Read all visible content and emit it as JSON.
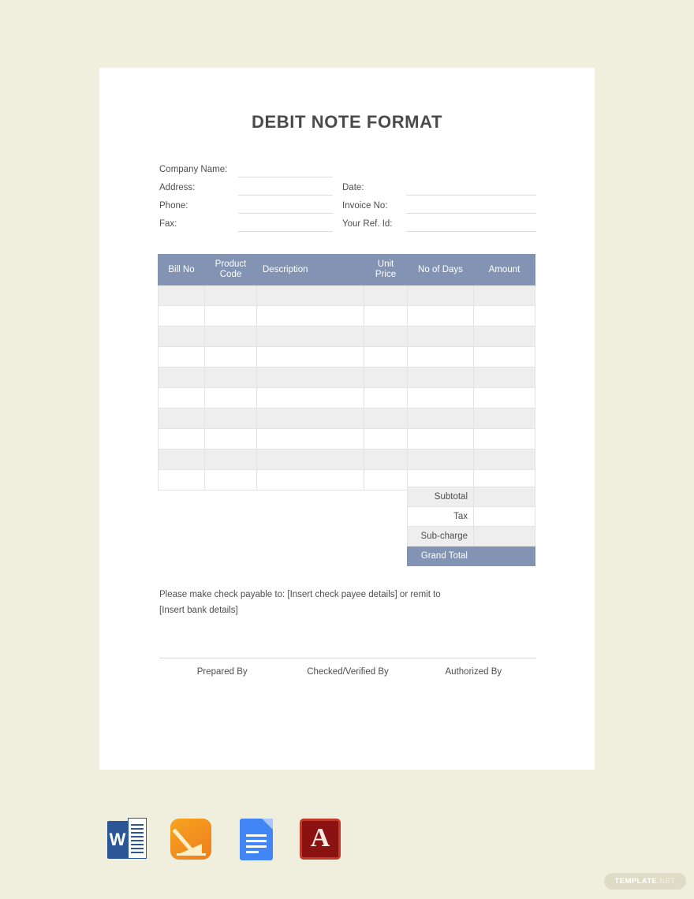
{
  "document": {
    "title": "DEBIT NOTE FORMAT",
    "background_color": "#f0eedc",
    "page_color": "#ffffff",
    "accent_color": "#8293b3"
  },
  "form": {
    "left_fields": [
      {
        "label": "Company Name:",
        "value": ""
      },
      {
        "label": "Address:",
        "value": ""
      },
      {
        "label": "Phone:",
        "value": ""
      },
      {
        "label": "Fax:",
        "value": ""
      }
    ],
    "right_fields": [
      {
        "label": "",
        "value": ""
      },
      {
        "label": "Date:",
        "value": ""
      },
      {
        "label": "Invoice No:",
        "value": ""
      },
      {
        "label": "Your Ref. Id:",
        "value": ""
      }
    ]
  },
  "table": {
    "headers": [
      "Bill No",
      "Product Code",
      "Description",
      "Unit Price",
      "No of Days",
      "Amount"
    ],
    "row_count": 10,
    "rows": [
      [
        "",
        "",
        "",
        "",
        "",
        ""
      ],
      [
        "",
        "",
        "",
        "",
        "",
        ""
      ],
      [
        "",
        "",
        "",
        "",
        "",
        ""
      ],
      [
        "",
        "",
        "",
        "",
        "",
        ""
      ],
      [
        "",
        "",
        "",
        "",
        "",
        ""
      ],
      [
        "",
        "",
        "",
        "",
        "",
        ""
      ],
      [
        "",
        "",
        "",
        "",
        "",
        ""
      ],
      [
        "",
        "",
        "",
        "",
        "",
        ""
      ],
      [
        "",
        "",
        "",
        "",
        "",
        ""
      ],
      [
        "",
        "",
        "",
        "",
        "",
        ""
      ]
    ]
  },
  "totals": [
    {
      "label": "Subtotal",
      "value": "",
      "style": "shade"
    },
    {
      "label": "Tax",
      "value": "",
      "style": "plain"
    },
    {
      "label": "Sub-charge",
      "value": "",
      "style": "shade"
    },
    {
      "label": "Grand Total",
      "value": "",
      "style": "grand"
    }
  ],
  "payment_note": {
    "line1": "Please make check payable to: [Insert check payee details] or remit to",
    "line2": "[Insert bank details]"
  },
  "signatures": [
    {
      "label": "Prepared By"
    },
    {
      "label": "Checked/Verified By"
    },
    {
      "label": "Authorized By"
    }
  ],
  "format_icons": [
    {
      "name": "microsoft-word-icon",
      "letter": "W"
    },
    {
      "name": "apple-pages-icon",
      "letter": ""
    },
    {
      "name": "google-docs-icon",
      "letter": ""
    },
    {
      "name": "adobe-pdf-icon",
      "letter": "A"
    }
  ],
  "watermark": {
    "main": "TEMPLATE",
    "tld": ".NET"
  }
}
